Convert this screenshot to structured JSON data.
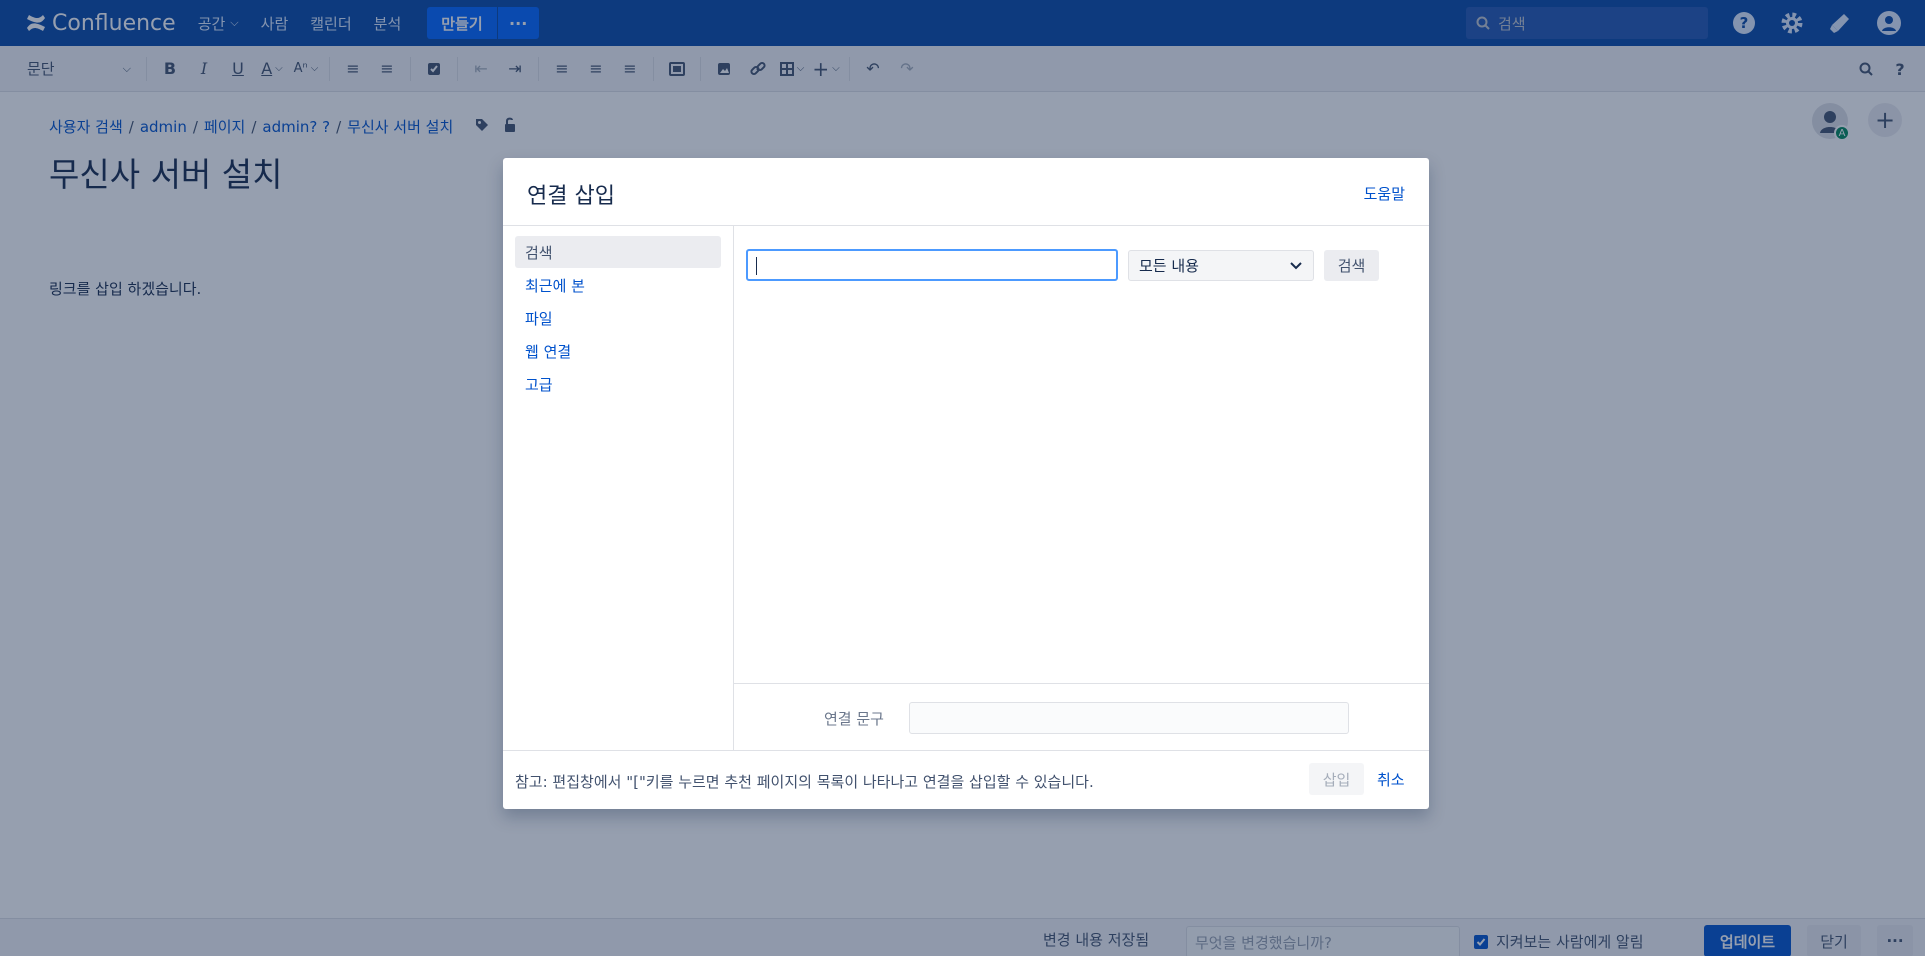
{
  "nav": {
    "logo": "Confluence",
    "spaces": "공간",
    "people": "사람",
    "calendar": "캘린더",
    "analytics": "분석",
    "create": "만들기",
    "more": "···",
    "search_placeholder": "검색"
  },
  "toolbar": {
    "paragraph": "문단"
  },
  "page": {
    "breadcrumb": [
      "사용자 검색",
      "admin",
      "페이지",
      "admin? ?",
      "무신사 서버 설치"
    ],
    "title": "무신사 서버 설치",
    "body": "링크를 삽입 하겠습니다.",
    "avatar_badge": "A"
  },
  "dialog": {
    "title": "연결 삽입",
    "help": "도움말",
    "sidebar": [
      "검색",
      "최근에 본",
      "파일",
      "웹 연결",
      "고급"
    ],
    "scope_value": "모든 내용",
    "search_button": "검색",
    "link_text_label": "연결 문구",
    "note": "참고: 편집창에서 \"[\"키를 누르면 추천 페이지의 목록이 나타나고 연결을 삽입할 수 있습니다.",
    "insert": "삽입",
    "cancel": "취소"
  },
  "bottom": {
    "saved": "변경 내용 저장됨",
    "change_placeholder": "무엇을 변경했습니까?",
    "notify": "지켜보는 사람에게 알림",
    "update": "업데이트",
    "close": "닫기",
    "more": "···"
  },
  "colors": {
    "nav_bg": "#0747a6",
    "accent": "#0052cc",
    "overlay": "rgba(23,43,77,0.45)"
  }
}
